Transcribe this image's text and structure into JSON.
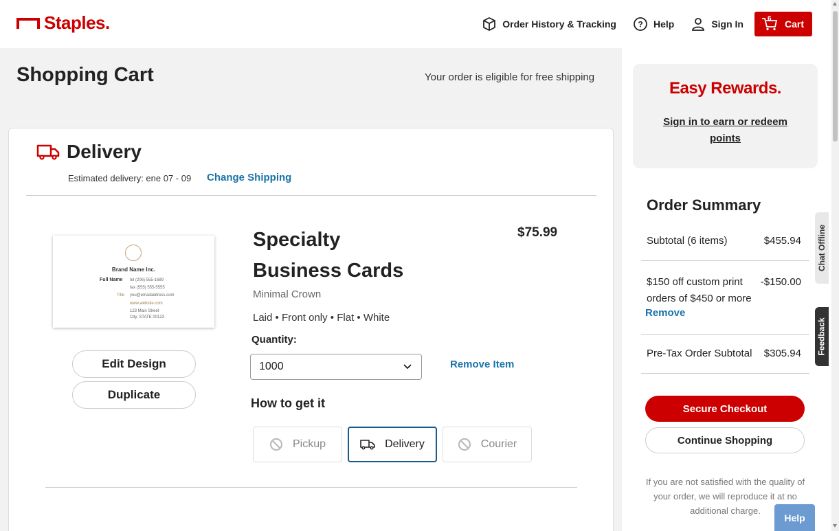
{
  "header": {
    "logo_text": "Staples.",
    "order_history": "Order History & Tracking",
    "help": "Help",
    "sign_in": "Sign In",
    "cart_label": "Cart",
    "cart_count": "6"
  },
  "page": {
    "title": "Shopping Cart",
    "free_shipping": "Your order is eligible for free shipping"
  },
  "delivery": {
    "title": "Delivery",
    "estimate": "Estimated delivery: ene 07 - 09",
    "change_shipping": "Change Shipping"
  },
  "item": {
    "name": "Specialty Business Cards",
    "price": "$75.99",
    "variant": "Minimal Crown",
    "specs": "Laid • Front only • Flat • White",
    "quantity_label": "Quantity:",
    "quantity_value": "1000",
    "remove": "Remove Item",
    "edit_design": "Edit Design",
    "duplicate": "Duplicate",
    "card_preview": {
      "brand": "Brand Name Inc.",
      "name": "Full Name",
      "title": "Title",
      "tel": "tel  (206) 555-1689",
      "fax": "fax  (555) 555-5555",
      "email": "you@emailaddress.com",
      "website": "www.website.com",
      "address1": "123 Main Street",
      "address2": "City, STATE 00123"
    }
  },
  "fulfillment": {
    "label": "How to get it",
    "options": [
      "Pickup",
      "Delivery",
      "Courier"
    ],
    "selected": "Delivery"
  },
  "rewards": {
    "logo": "Easy Rewards.",
    "link": "Sign in to earn or redeem points"
  },
  "summary": {
    "title": "Order Summary",
    "subtotal_label": "Subtotal (6 items)",
    "subtotal_value": "$455.94",
    "promo_label": "$150 off custom print orders of $450 or more",
    "promo_value": "-$150.00",
    "promo_remove": "Remove",
    "pretax_label": "Pre-Tax Order Subtotal",
    "pretax_value": "$305.94",
    "checkout": "Secure Checkout",
    "continue": "Continue Shopping",
    "guarantee": "If you are not satisfied with the quality of your order, we will reproduce it at no additional charge."
  },
  "widgets": {
    "chat": "Chat Offline",
    "feedback": "Feedback",
    "help": "Help"
  },
  "colors": {
    "brand_red": "#cc0000",
    "link_blue": "#1a73a8",
    "selected_border": "#1a5a8a"
  }
}
